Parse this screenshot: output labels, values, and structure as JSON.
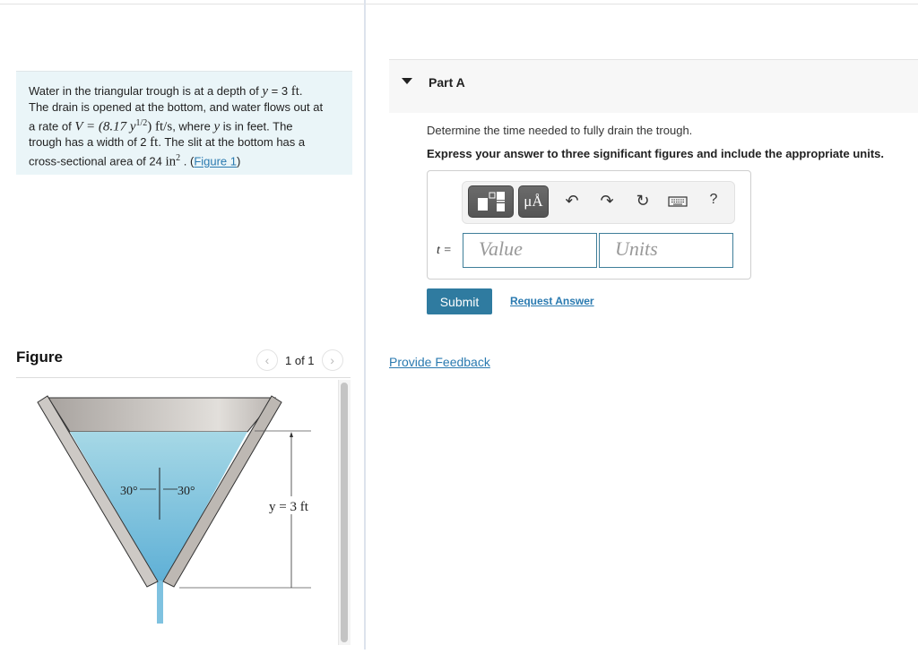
{
  "problem": {
    "line1_pre": "Water in the triangular trough is at a depth of ",
    "line1_var": "y",
    "line1_eq": " = 3 ",
    "line1_unit": "ft",
    "line1_post": ".",
    "line2": "The drain is opened at the bottom, and water flows out at",
    "line3_pre": "a rate of ",
    "line3_formula": "V = (8.17 y",
    "line3_exp": "1/2",
    "line3_formula_end": ") ft/s",
    "line3_post": ", where ",
    "line3_var": "y",
    "line3_end": " is in feet. The",
    "line4_pre": "trough has a width of 2 ",
    "line4_unit": "ft",
    "line4_post": ". The slit at the bottom has a",
    "line5_pre": "cross-sectional area of 24 ",
    "line5_unit": "in",
    "line5_exp": "2",
    "line5_post": " . (",
    "figure_link": "Figure 1",
    "line5_close": ")"
  },
  "figure": {
    "title": "Figure",
    "pager_text": "1 of 1",
    "prev_icon": "chevron-left-icon",
    "next_icon": "chevron-right-icon",
    "angle_left": "30°",
    "angle_right": "30°",
    "depth_label": "y = 3 ft",
    "colors": {
      "water_top": "#a6d8e6",
      "water_bottom": "#5fb0d6",
      "wall": "#c8c4c0",
      "back": "#b5b1ad"
    }
  },
  "part_a": {
    "title": "Part A",
    "question": "Determine the time needed to fully drain the trough.",
    "instruction": "Express your answer to three significant figures and include the appropriate units.",
    "toolbar": {
      "templates_icon": "templates-icon",
      "units_label": "μÅ",
      "undo_icon": "undo-icon",
      "redo_icon": "redo-icon",
      "reset_icon": "reset-icon",
      "keyboard_icon": "keyboard-icon",
      "help_label": "?"
    },
    "variable_label": "t =",
    "value_placeholder": "Value",
    "units_placeholder": "Units",
    "submit_label": "Submit",
    "request_answer_label": "Request Answer"
  },
  "feedback_label": "Provide Feedback",
  "colors": {
    "accent": "#2f7ba0",
    "link": "#2a7ab0",
    "problem_bg": "#eaf5f8"
  }
}
